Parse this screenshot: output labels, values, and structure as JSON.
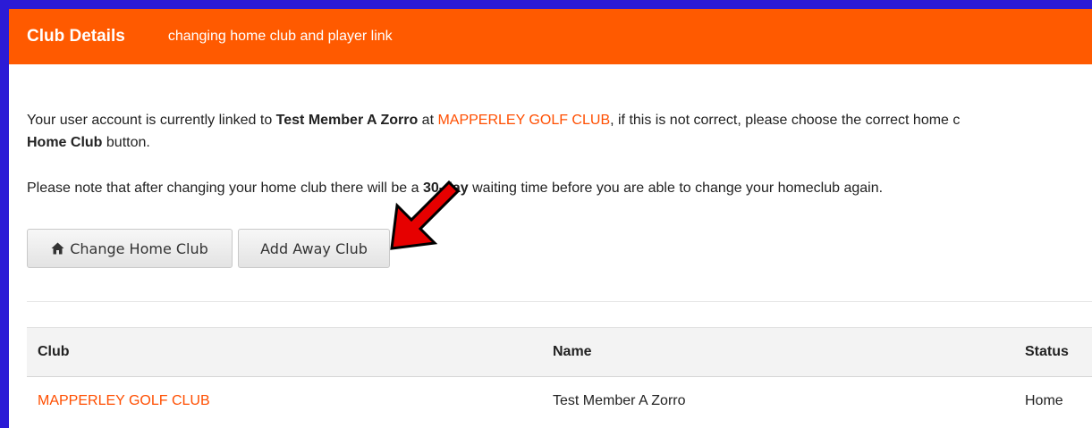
{
  "header": {
    "title": "Club Details",
    "subtitle": "changing home club and player link"
  },
  "intro": {
    "p1_a": "Your user account is currently linked to ",
    "member": "Test Member A Zorro",
    "p1_b": " at ",
    "club": "MAPPERLEY GOLF CLUB",
    "p1_c": ", if this is not correct, please choose the correct home c",
    "p1_d_bold": "Home Club",
    "p1_e": " button.",
    "p2_a": "Please note that after changing your home club there will be a ",
    "p2_bold": "30-day",
    "p2_b": " waiting time before you are able to change your homeclub again."
  },
  "buttons": {
    "change_home": "Change Home Club",
    "add_away": "Add Away Club"
  },
  "table": {
    "headers": [
      "Club",
      "Name",
      "Status"
    ],
    "rows": [
      [
        "MAPPERLEY GOLF CLUB",
        "Test Member A Zorro",
        "Home"
      ]
    ]
  },
  "colors": {
    "accent": "#ff5a00",
    "link": "#ff4e00",
    "annotation_arrow": "#e60000"
  },
  "icons": {
    "change_home": "home-icon",
    "annotation": "red-arrow-icon"
  }
}
